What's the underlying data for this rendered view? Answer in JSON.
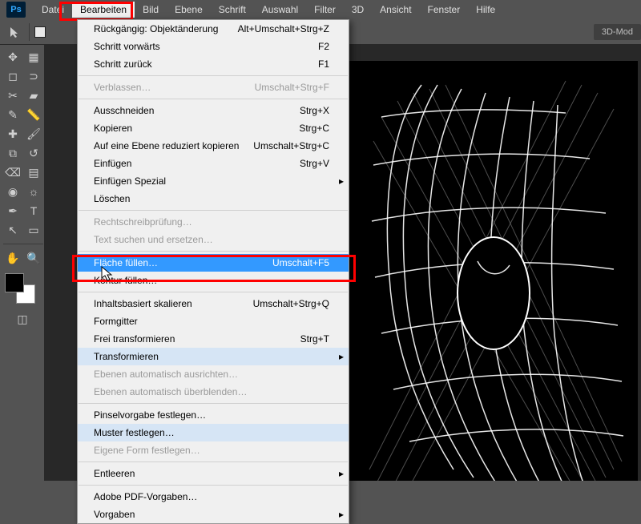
{
  "app": {
    "logo": "Ps"
  },
  "menubar": {
    "items": [
      "Datei",
      "Bearbeiten",
      "Bild",
      "Ebene",
      "Schrift",
      "Auswahl",
      "Filter",
      "3D",
      "Ansicht",
      "Fenster",
      "Hilfe"
    ],
    "open_index": 1
  },
  "options_bar": {
    "right_label": "3D-Mod"
  },
  "dropdown": {
    "groups": [
      [
        {
          "label": "Rückgängig: Objektänderung",
          "shortcut": "Alt+Umschalt+Strg+Z",
          "enabled": true
        },
        {
          "label": "Schritt vorwärts",
          "shortcut": "F2",
          "enabled": true
        },
        {
          "label": "Schritt zurück",
          "shortcut": "F1",
          "enabled": true
        }
      ],
      [
        {
          "label": "Verblassen…",
          "shortcut": "Umschalt+Strg+F",
          "enabled": false
        }
      ],
      [
        {
          "label": "Ausschneiden",
          "shortcut": "Strg+X",
          "enabled": true
        },
        {
          "label": "Kopieren",
          "shortcut": "Strg+C",
          "enabled": true
        },
        {
          "label": "Auf eine Ebene reduziert kopieren",
          "shortcut": "Umschalt+Strg+C",
          "enabled": true
        },
        {
          "label": "Einfügen",
          "shortcut": "Strg+V",
          "enabled": true
        },
        {
          "label": "Einfügen Spezial",
          "shortcut": "",
          "enabled": true,
          "submenu": true
        },
        {
          "label": "Löschen",
          "shortcut": "",
          "enabled": true
        }
      ],
      [
        {
          "label": "Rechtschreibprüfung…",
          "shortcut": "",
          "enabled": false
        },
        {
          "label": "Text suchen und ersetzen…",
          "shortcut": "",
          "enabled": false
        }
      ],
      [
        {
          "label": "Fläche füllen…",
          "shortcut": "Umschalt+F5",
          "enabled": true,
          "highlight": true
        },
        {
          "label": "Kontur füllen…",
          "shortcut": "",
          "enabled": true
        }
      ],
      [
        {
          "label": "Inhaltsbasiert skalieren",
          "shortcut": "Umschalt+Strg+Q",
          "enabled": true
        },
        {
          "label": "Formgitter",
          "shortcut": "",
          "enabled": true
        },
        {
          "label": "Frei transformieren",
          "shortcut": "Strg+T",
          "enabled": true
        },
        {
          "label": "Transformieren",
          "shortcut": "",
          "enabled": true,
          "submenu": true,
          "subhover": true
        },
        {
          "label": "Ebenen automatisch ausrichten…",
          "shortcut": "",
          "enabled": false
        },
        {
          "label": "Ebenen automatisch überblenden…",
          "shortcut": "",
          "enabled": false
        }
      ],
      [
        {
          "label": "Pinselvorgabe festlegen…",
          "shortcut": "",
          "enabled": true
        },
        {
          "label": "Muster festlegen…",
          "shortcut": "",
          "enabled": true,
          "subhover": true
        },
        {
          "label": "Eigene Form festlegen…",
          "shortcut": "",
          "enabled": false
        }
      ],
      [
        {
          "label": "Entleeren",
          "shortcut": "",
          "enabled": true,
          "submenu": true
        }
      ],
      [
        {
          "label": "Adobe PDF-Vorgaben…",
          "shortcut": "",
          "enabled": true
        },
        {
          "label": "Vorgaben",
          "shortcut": "",
          "enabled": true,
          "submenu": true
        }
      ]
    ]
  },
  "tools": {
    "names": [
      "move",
      "artboard",
      "marquee",
      "lasso",
      "crop",
      "slice",
      "eyedropper",
      "ruler",
      "heal",
      "brush",
      "stamp",
      "history-brush",
      "eraser",
      "gradient",
      "blur",
      "dodge",
      "pen",
      "type",
      "path-select",
      "shape",
      "hand",
      "zoom"
    ]
  }
}
